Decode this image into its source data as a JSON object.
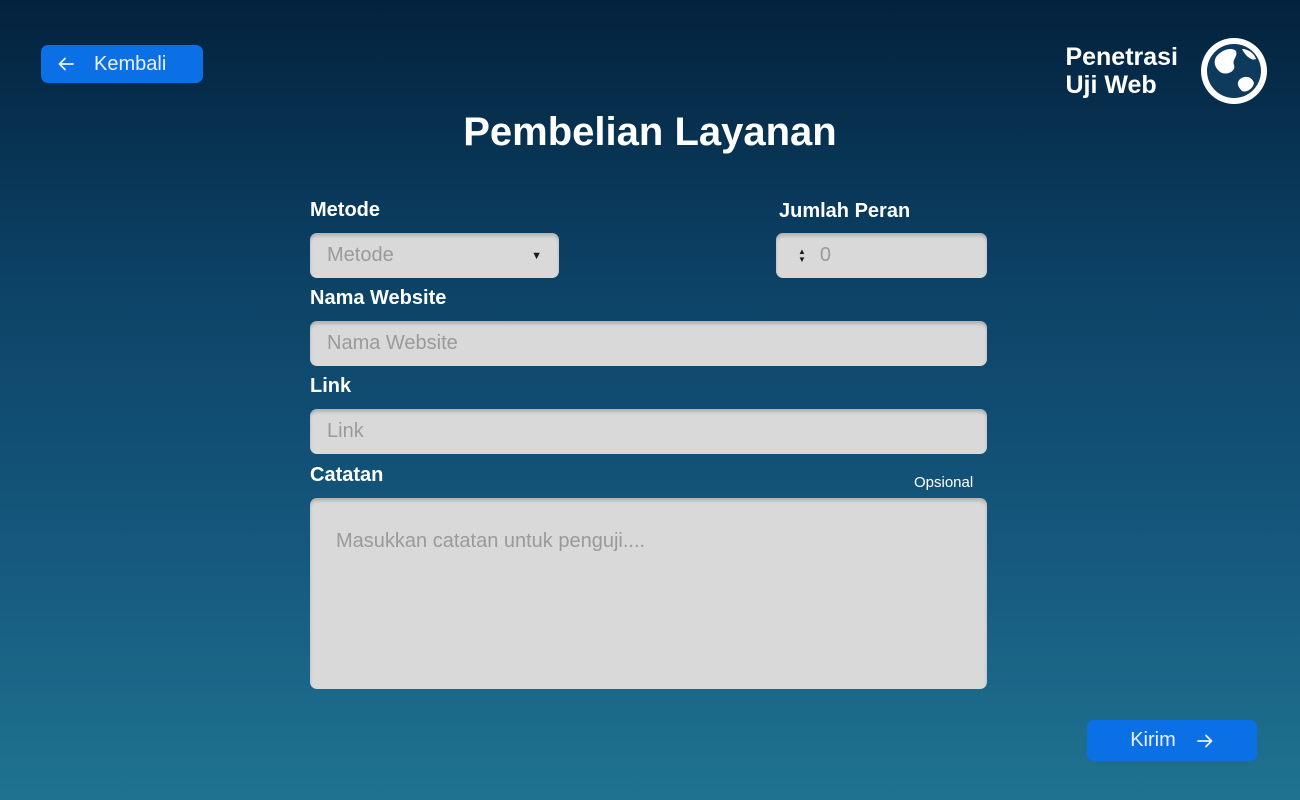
{
  "header": {
    "back_label": "Kembali",
    "brand_line1": "Penetrasi",
    "brand_line2": "Uji Web",
    "title": "Pembelian Layanan"
  },
  "form": {
    "metode": {
      "label": "Metode",
      "placeholder": "Metode"
    },
    "jumlah_peran": {
      "label": "Jumlah Peran",
      "value": "0"
    },
    "nama_website": {
      "label": "Nama Website",
      "placeholder": "Nama Website"
    },
    "link": {
      "label": "Link",
      "placeholder": "Link"
    },
    "catatan": {
      "label": "Catatan",
      "optional_label": "Opsional",
      "placeholder": "Masukkan catatan untuk penguji...."
    },
    "submit_label": "Kirim"
  },
  "colors": {
    "accent": "#0b6fe6",
    "input_bg": "#d9d9d9",
    "placeholder": "#9a9a9a"
  },
  "icons": {
    "back": "arrow-left-icon",
    "brand": "globe-icon",
    "dropdown": "caret-down-icon",
    "stepper": "stepper-arrows-icon",
    "submit": "arrow-right-icon"
  }
}
